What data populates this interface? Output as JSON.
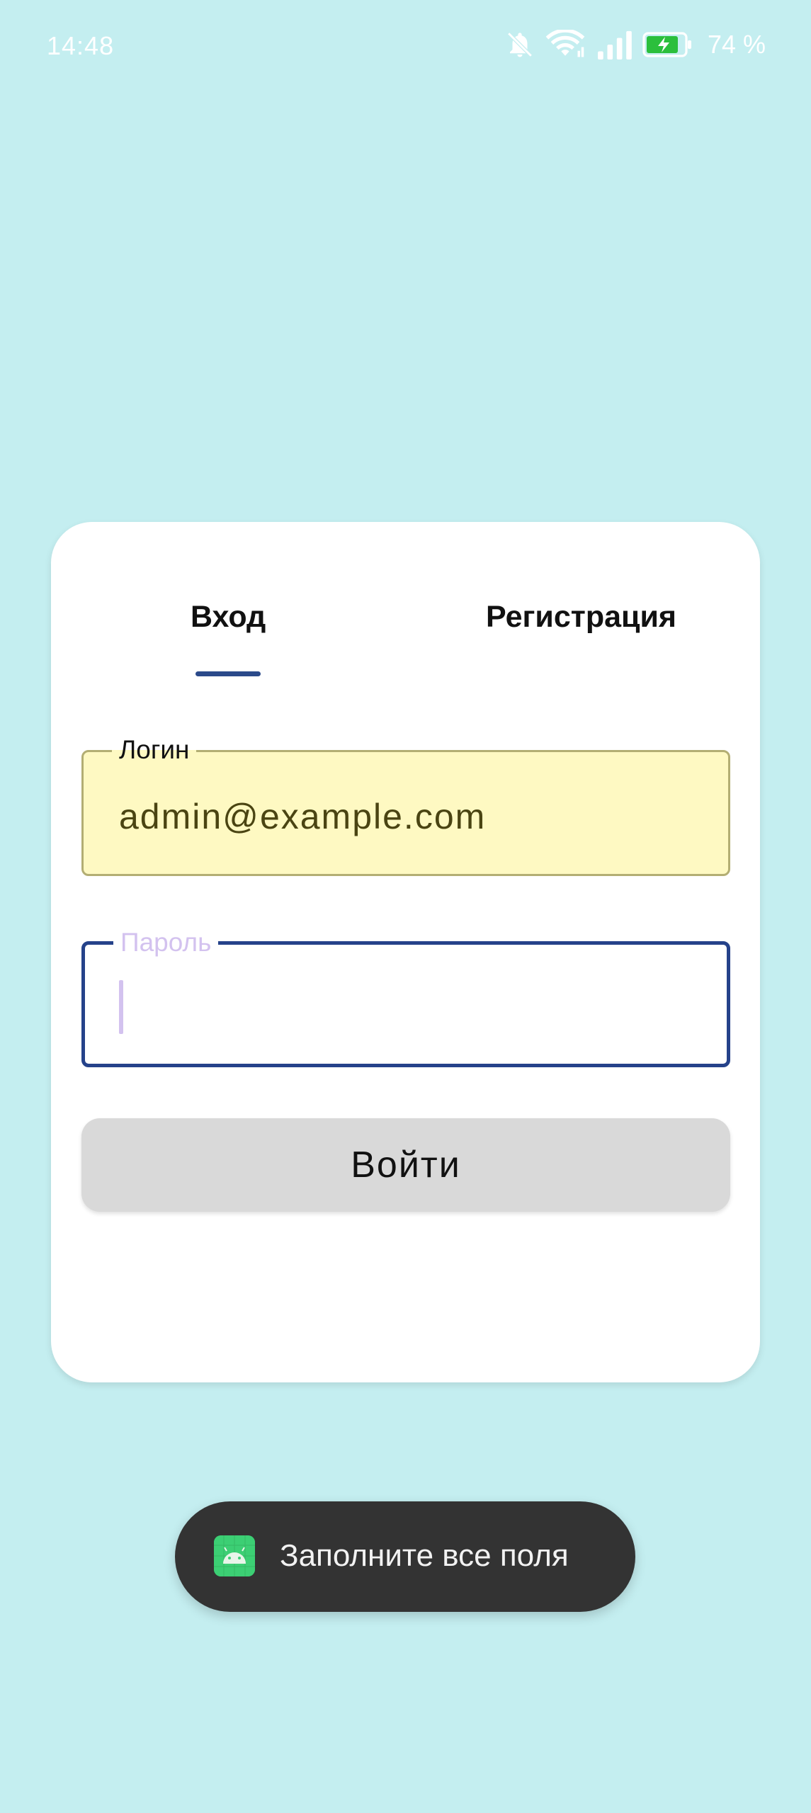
{
  "status_bar": {
    "time": "14:48",
    "battery_percent": "74 %",
    "icons": [
      "bell-off-icon",
      "wifi-icon",
      "signal-icon",
      "battery-charging-icon"
    ]
  },
  "tabs": [
    {
      "label": "Вход",
      "selected": true
    },
    {
      "label": "Регистрация",
      "selected": false
    }
  ],
  "form": {
    "login": {
      "label": "Логин",
      "value": "admin@example.com"
    },
    "password": {
      "label": "Пароль",
      "value": ""
    },
    "submit_label": "Войти"
  },
  "toast": {
    "icon": "android-app-icon",
    "message": "Заполните все поля"
  },
  "colors": {
    "background": "#c4eef0",
    "card": "#ffffff",
    "accent": "#25428a",
    "autofill": "#fef9c2",
    "button": "#d9d9d9",
    "toast": "#333333",
    "hint": "#d3c2ef"
  }
}
